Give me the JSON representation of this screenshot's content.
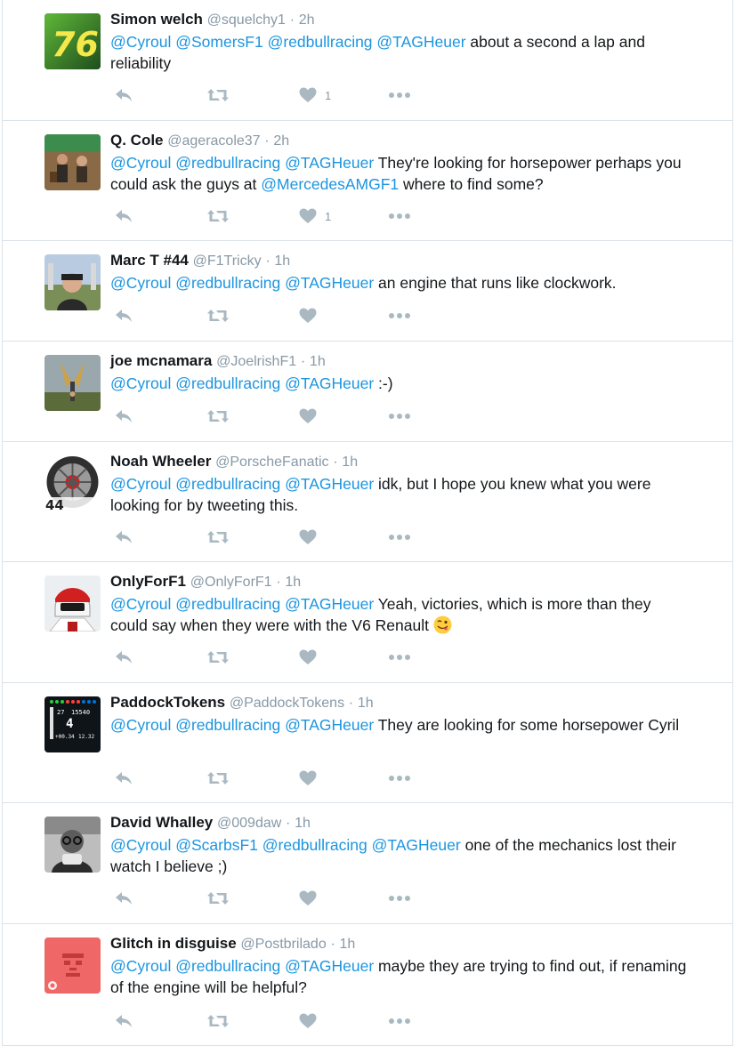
{
  "colors": {
    "mention": "#1b95e0",
    "muted": "#8899a6",
    "icon": "#aab8c2",
    "divider": "#dbe2e8"
  },
  "tweets": [
    {
      "name": "Simon welch",
      "handle": "@squelchy1",
      "separator": "·",
      "time": "2h",
      "mentions": [
        "@Cyroul",
        "@SomersF1",
        "@redbullracing",
        "@TAGHeuer"
      ],
      "text": "about a second a lap and reliability",
      "like_count": "1",
      "avatar": "number-76-avatar"
    },
    {
      "name": "Q. Cole",
      "handle": "@ageracole37",
      "separator": "·",
      "time": "2h",
      "mentions": [
        "@Cyroul",
        "@redbullracing",
        "@TAGHeuer"
      ],
      "text_a": "They're looking for horsepower perhaps you could ask the guys at",
      "mention_mid": "@MercedesAMGF1",
      "text_b": "where to find some?",
      "like_count": "1",
      "avatar": "people-photo-avatar"
    },
    {
      "name": "Marc T #44",
      "handle": "@F1Tricky",
      "separator": "·",
      "time": "1h",
      "mentions": [
        "@Cyroul",
        "@redbullracing",
        "@TAGHeuer"
      ],
      "text": "an engine that runs like clockwork.",
      "like_count": "",
      "avatar": "man-selfie-avatar"
    },
    {
      "name": "joe mcnamara",
      "handle": "@JoelrishF1",
      "separator": "·",
      "time": "1h",
      "mentions": [
        "@Cyroul",
        "@redbullracing",
        "@TAGHeuer"
      ],
      "text": ":-)",
      "like_count": "",
      "avatar": "statue-photo-avatar"
    },
    {
      "name": "Noah Wheeler",
      "handle": "@PorscheFanatic",
      "separator": "·",
      "time": "1h",
      "mentions": [
        "@Cyroul",
        "@redbullracing",
        "@TAGHeuer"
      ],
      "text": "idk, but I hope you knew what you were looking for by tweeting this.",
      "like_count": "",
      "avatar": "wheel-44-avatar",
      "avatar_label": "44"
    },
    {
      "name": "OnlyForF1",
      "handle": "@OnlyForF1",
      "separator": "·",
      "time": "1h",
      "mentions": [
        "@Cyroul",
        "@redbullracing",
        "@TAGHeuer"
      ],
      "text": "Yeah, victories, which is more than they could say when they were with the V6 Renault",
      "emoji": "winking-face-tongue-emoji",
      "like_count": "",
      "avatar": "helmet-avatar"
    },
    {
      "name": "PaddockTokens",
      "handle": "@PaddockTokens",
      "separator": "·",
      "time": "1h",
      "mentions": [
        "@Cyroul",
        "@redbullracing",
        "@TAGHeuer"
      ],
      "text": "They are looking for some horsepower Cyril",
      "like_count": "",
      "avatar": "steering-display-avatar",
      "avatar_texts": [
        "27",
        "15540",
        "4",
        "+00.34",
        "12.32"
      ]
    },
    {
      "name": "David Whalley",
      "handle": "@009daw",
      "separator": "·",
      "time": "1h",
      "mentions": [
        "@Cyroul",
        "@ScarbsF1",
        "@redbullracing",
        "@TAGHeuer"
      ],
      "text": "one of the mechanics lost their watch I believe ;)",
      "like_count": "",
      "avatar": "bw-photo-avatar"
    },
    {
      "name": "Glitch in disguise",
      "handle": "@Postbrilado",
      "separator": "·",
      "time": "1h",
      "mentions": [
        "@Cyroul",
        "@redbullracing",
        "@TAGHeuer"
      ],
      "text": "maybe they are trying to find out, if renaming of the engine will be helpful?",
      "like_count": "",
      "avatar": "stormtrooper-avatar"
    }
  ]
}
